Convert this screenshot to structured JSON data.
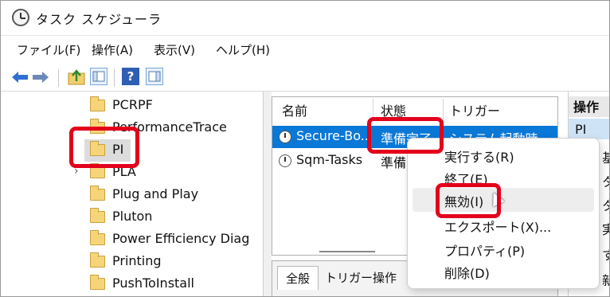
{
  "window": {
    "title": "タスク スケジューラ"
  },
  "menu": [
    "ファイル(F)",
    "操作(A)",
    "表示(V)",
    "ヘルプ(H)"
  ],
  "toolbar": {
    "help_label": "?"
  },
  "tree": {
    "items": [
      {
        "label": "PCRPF"
      },
      {
        "label": "PerformanceTrace"
      },
      {
        "label": "PI",
        "selected": true
      },
      {
        "label": "PLA",
        "collapsed": true
      },
      {
        "label": "Plug and Play"
      },
      {
        "label": "Pluton"
      },
      {
        "label": "Power Efficiency Diag"
      },
      {
        "label": "Printing"
      },
      {
        "label": "PushToInstall"
      }
    ]
  },
  "task_list": {
    "columns": [
      "名前",
      "状態",
      "トリガー"
    ],
    "rows": [
      {
        "name": "Secure-Bo...",
        "status": "準備完了",
        "trigger": "システム起動時",
        "selected": true
      },
      {
        "name": "Sqm-Tasks",
        "status": "準備",
        "trigger": ""
      }
    ]
  },
  "details_tabs": [
    "全般",
    "トリガー",
    "操作"
  ],
  "actions_pane": {
    "header": "操作",
    "selected": "PI",
    "items": [
      "基",
      "タ",
      "タ",
      "実",
      "す",
      "新"
    ]
  },
  "context_menu": {
    "items": [
      "実行する(R)",
      "終了(E)",
      "無効(I)",
      "エクスポート(X)...",
      "プロパティ(P)",
      "削除(D)"
    ],
    "hovered": "無効(I)"
  },
  "highlight_color": "#e3001b",
  "selection_color": "#0a78d7"
}
